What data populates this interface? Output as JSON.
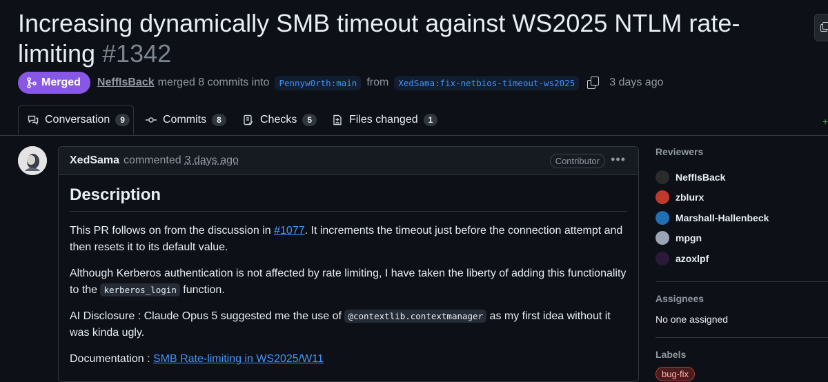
{
  "header": {
    "title": "Increasing dynamically SMB timeout against WS2025 NTLM rate-limiting",
    "number": "#1342"
  },
  "meta": {
    "status": "Merged",
    "author": "NeffIsBack",
    "merged_text": "merged 8 commits into",
    "base_branch": "Pennyw0rth:main",
    "from_text": "from",
    "head_branch": "XedSama:fix-netbios-timeout-ws2025",
    "time": "3 days ago"
  },
  "tabs": [
    {
      "label": "Conversation",
      "count": "9"
    },
    {
      "label": "Commits",
      "count": "8"
    },
    {
      "label": "Checks",
      "count": "5"
    },
    {
      "label": "Files changed",
      "count": "1"
    }
  ],
  "comment": {
    "author": "XedSama",
    "action": "commented",
    "time": "3 days ago",
    "role": "Contributor",
    "heading": "Description",
    "p1_a": "This PR follows on from the discussion in ",
    "p1_link": "#1077",
    "p1_b": ". It increments the timeout just before the connection attempt and then resets it to its default value.",
    "p2_a": "Although Kerberos authentication is not affected by rate limiting, I have taken the liberty of adding this functionality to the ",
    "p2_code": "kerberos_login",
    "p2_b": " function.",
    "p3_a": "AI Disclosure : Claude Opus 5 suggested me the use of ",
    "p3_code": "@contextlib.contextmanager",
    "p3_b": " as my first idea without it was kinda ugly.",
    "p4_a": "Documentation : ",
    "p4_link": "SMB Rate-limiting in WS2025/W11"
  },
  "sidebar": {
    "reviewers_heading": "Reviewers",
    "reviewers": [
      {
        "name": "NeffIsBack",
        "color": "#2b2b2b"
      },
      {
        "name": "zblurx",
        "color": "#c0392b"
      },
      {
        "name": "Marshall-Hallenbeck",
        "color": "#1f6fb2"
      },
      {
        "name": "mpgn",
        "color": "#9aa4b5"
      },
      {
        "name": "azoxlpf",
        "color": "#2a1a3a"
      }
    ],
    "assignees_heading": "Assignees",
    "assignees_text": "No one assigned",
    "labels_heading": "Labels",
    "label": "bug-fix"
  }
}
